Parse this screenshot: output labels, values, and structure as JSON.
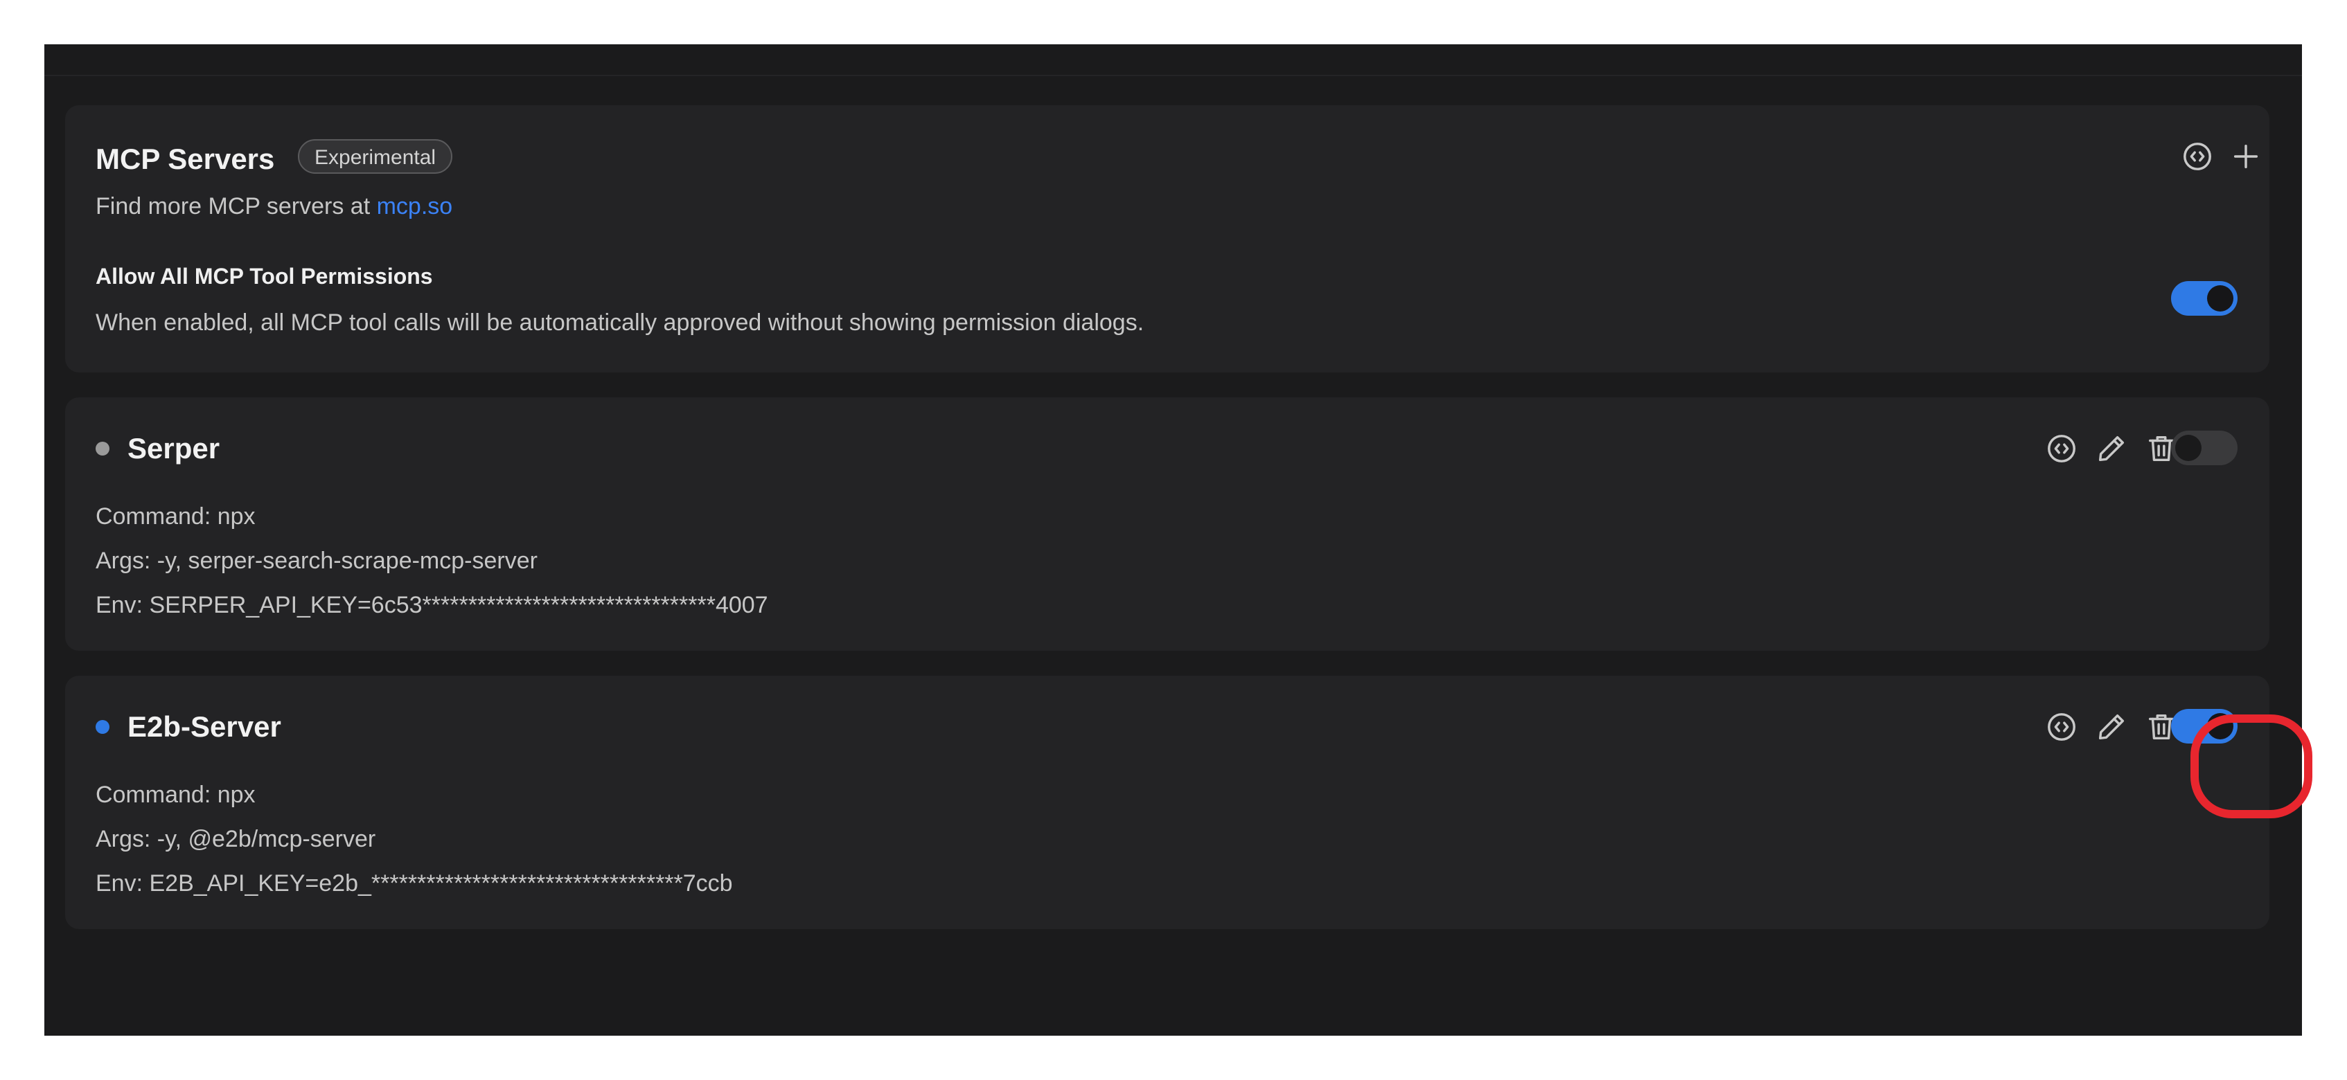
{
  "header": {
    "title": "MCP Servers",
    "badge": "Experimental",
    "find_more_prefix": "Find more MCP servers at ",
    "find_more_link": "mcp.so",
    "permissions_title": "Allow All MCP Tool Permissions",
    "permissions_desc": "When enabled, all MCP tool calls will be automatically approved without showing permission dialogs.",
    "permissions_enabled": true,
    "icons": [
      "code-icon",
      "plus-icon"
    ]
  },
  "servers": [
    {
      "name": "Serper",
      "status_color": "#9a9a9a",
      "enabled": false,
      "command": "Command: npx",
      "args": "Args: -y, serper-search-scrape-mcp-server",
      "env": "Env: SERPER_API_KEY=6c53********************************4007"
    },
    {
      "name": "E2b-Server",
      "status_color": "#2f7ae5",
      "enabled": true,
      "command": "Command: npx",
      "args": "Args: -y, @e2b/mcp-server",
      "env": "Env: E2B_API_KEY=e2b_**********************************7ccb"
    }
  ],
  "colors": {
    "accent": "#2f7ae5",
    "highlight": "#e8262e",
    "card": "#232325",
    "background": "#1b1b1c"
  }
}
